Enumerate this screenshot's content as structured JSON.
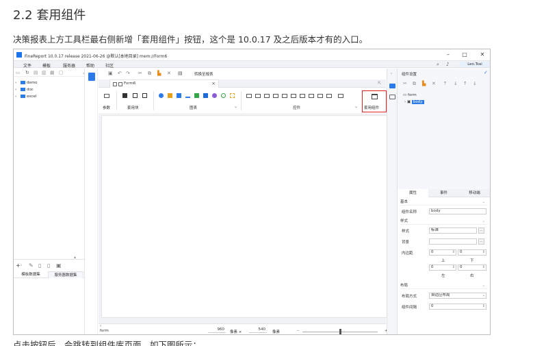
{
  "doc": {
    "heading": "2.2 套用组件",
    "paragraph": "决策报表上方工具栏最右侧新增「套用组件」按钮，这个是 10.0.17 及之后版本才有的入口。",
    "bottom_text": "点击按钮后，会跳转到组件库页面，如下图所示："
  },
  "window": {
    "title": "FineReport 10.0.17 release 2021-06-26 @默认[本地目录]   mem://Form6",
    "controls": {
      "minimize": "–",
      "maximize": "□",
      "close": "✕"
    }
  },
  "menu": {
    "items": [
      "文件",
      "模板",
      "服务器",
      "帮助",
      "社区"
    ],
    "search_icon": "magnifier",
    "bell_icon": "bell",
    "user": "Leo.Tsai"
  },
  "left_pane": {
    "tree": [
      "demo",
      "doc",
      "excel"
    ],
    "bottom_tabs": [
      "模板数据集",
      "服务器数据集"
    ]
  },
  "editor": {
    "quick_toolbar_label": "转换至报表",
    "tab_label": "Form6",
    "ribbon": {
      "groups": [
        "参数",
        "套用块",
        "图表",
        "控件"
      ],
      "apply_component": "套用组件"
    },
    "status": {
      "left": "form",
      "width_value": "960",
      "width_unit": "像素 ×",
      "height_value": "540",
      "height_unit": "像素",
      "minus": "–",
      "plus": "+"
    }
  },
  "right_pane": {
    "title": "组件设置",
    "tree_root": "form",
    "tree_child": "body",
    "tabs": [
      "属性",
      "事件",
      "移动端"
    ],
    "sections": {
      "basic": "基本",
      "style": "样式",
      "layout": "布局"
    },
    "fields": {
      "widget_name_label": "组件名称",
      "widget_name_value": "body",
      "style_label": "样式",
      "style_value": "标准",
      "background_label": "背景",
      "padding_label": "内边距",
      "padding_top": "0",
      "padding_bottom": "0",
      "padding_left": "0",
      "padding_right": "0",
      "top_label": "上",
      "bottom_label": "下",
      "left_label": "左",
      "right_label": "右",
      "layout_mode_label": "布局方式",
      "layout_mode_value": "自适应布局",
      "spacing_label": "组件间隔",
      "spacing_value": "0"
    }
  }
}
